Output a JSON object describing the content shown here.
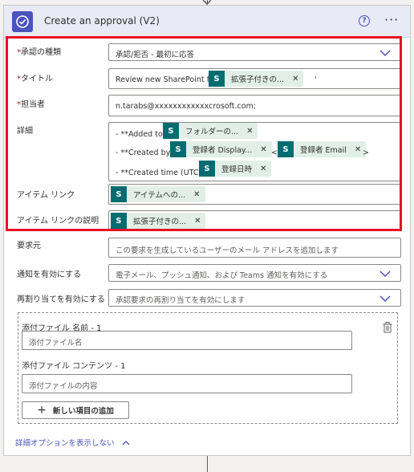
{
  "header": {
    "title": "Create an approval (V2)",
    "help": "?",
    "more": "···"
  },
  "approval_type": {
    "label": "承認の種類",
    "value": "承認/拒否 - 最初に応答"
  },
  "title_field": {
    "label": "タイトル",
    "prefix": "Review new SharePoint file '",
    "token": "拡張子付きの...",
    "suffix": "'"
  },
  "assignee": {
    "label": "担当者",
    "value": "n.tarabs@xxxxxxxxxxxxcrosoft.com;"
  },
  "details": {
    "label": "詳細",
    "line1_prefix": "- **Added to:**",
    "line1_token": "フォルダーの...",
    "line2_prefix": "- **Created by:**",
    "line2_token": "登録者 Display...",
    "line2_mid": "<",
    "line2_token2": "登録者 Email",
    "line2_suffix": ">",
    "line3_prefix": "- **Created time (UTC):**",
    "line3_token": "登録日時"
  },
  "item_link": {
    "label": "アイテム リンク",
    "token": "アイテムへの..."
  },
  "item_link_desc": {
    "label": "アイテム リンクの説明",
    "token": "拡張子付きの..."
  },
  "requestor": {
    "label": "要求元",
    "placeholder": "この要求を生成しているユーザーのメール アドレスを追加します"
  },
  "notify": {
    "label": "通知を有効にする",
    "placeholder": "電子メール、プッシュ通知、および Teams 通知を有効にする"
  },
  "reassign": {
    "label": "再割り当てを有効にする",
    "placeholder": "承認要求の再割り当てを有効にします"
  },
  "attachments": {
    "name_label": "添付ファイル 名前 - 1",
    "name_placeholder": "添付ファイル名",
    "content_label": "添付ファイル コンテンツ - 1",
    "content_placeholder": "添付ファイルの内容",
    "add_label": "新しい項目の追加",
    "add_plus": "+"
  },
  "advanced_link": "詳細オプションを表示しない",
  "token_icon_letter": "S",
  "colors": {
    "accent": "#4b53bc",
    "highlight": "#e81123",
    "token_bg": "#e1efe8",
    "sharepoint": "#036c70"
  }
}
